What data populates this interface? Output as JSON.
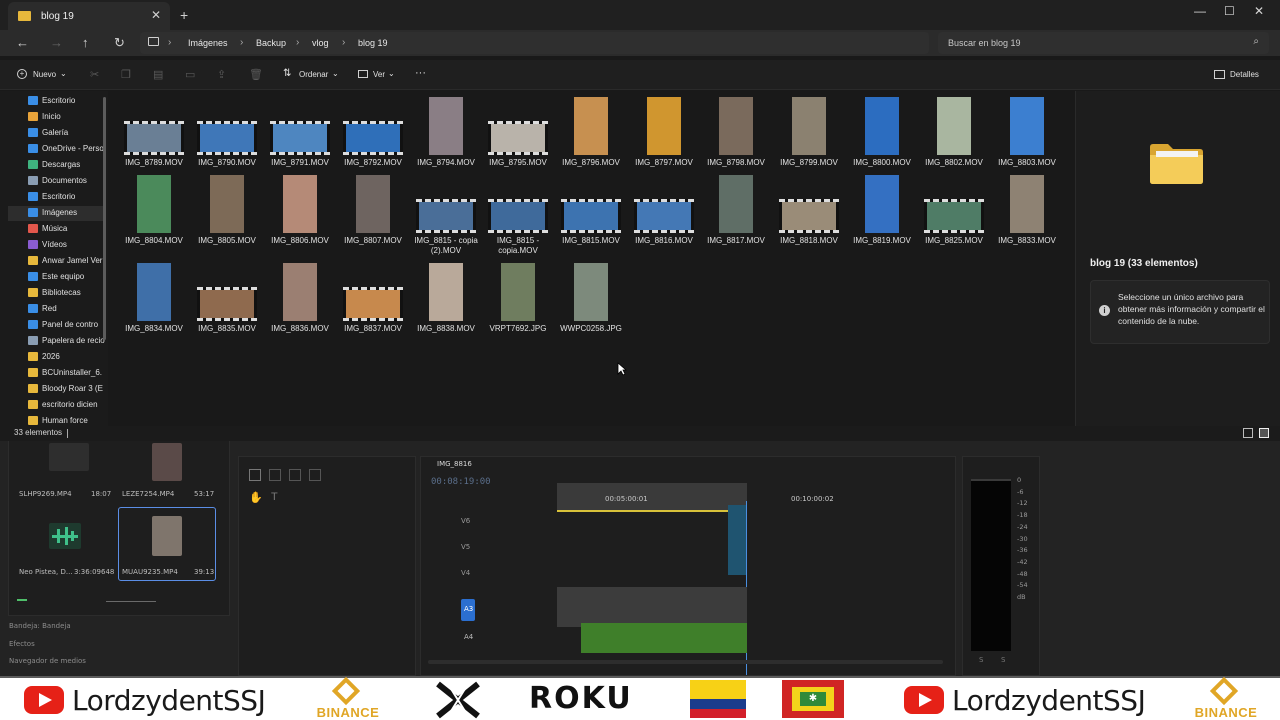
{
  "explorer": {
    "tab_title": "blog 19",
    "breadcrumb": [
      "Imágenes",
      "Backup",
      "vlog",
      "blog 19"
    ],
    "search_placeholder": "Buscar en blog 19",
    "commands": {
      "new": "Nuevo",
      "sort": "Ordenar",
      "view": "Ver",
      "more": "···",
      "details": "Detalles"
    },
    "nav_items": [
      {
        "label": "Escritorio",
        "icon": "desktop-icon",
        "color": "#3a8ee6"
      },
      {
        "label": "Inicio",
        "icon": "home-icon",
        "color": "#e8a33a"
      },
      {
        "label": "Galería",
        "icon": "gallery-icon",
        "color": "#3a8ee6"
      },
      {
        "label": "OneDrive - Perso",
        "icon": "cloud-icon",
        "color": "#3a8ee6"
      },
      {
        "label": "Descargas",
        "icon": "download-icon",
        "color": "#3fb37f"
      },
      {
        "label": "Documentos",
        "icon": "document-icon",
        "color": "#8a9db3"
      },
      {
        "label": "Escritorio",
        "icon": "desktop-icon",
        "color": "#3a8ee6"
      },
      {
        "label": "Imágenes",
        "icon": "pictures-icon",
        "color": "#3a8ee6"
      },
      {
        "label": "Música",
        "icon": "music-icon",
        "color": "#e2574c"
      },
      {
        "label": "Vídeos",
        "icon": "video-icon",
        "color": "#8a5cd1"
      },
      {
        "label": "Anwar Jamel Ver",
        "icon": "user-icon",
        "color": "#e7b83c"
      },
      {
        "label": "Este equipo",
        "icon": "computer-icon",
        "color": "#3a8ee6"
      },
      {
        "label": "Bibliotecas",
        "icon": "library-icon",
        "color": "#e7b83c"
      },
      {
        "label": "Red",
        "icon": "network-icon",
        "color": "#3a8ee6"
      },
      {
        "label": "Panel de contro",
        "icon": "control-panel-icon",
        "color": "#3a8ee6"
      },
      {
        "label": "Papelera de recio",
        "icon": "recycle-bin-icon",
        "color": "#8a9db3"
      },
      {
        "label": "2026",
        "icon": "folder-icon",
        "color": "#e7b83c"
      },
      {
        "label": "BCUninstaller_6.",
        "icon": "folder-icon",
        "color": "#e7b83c"
      },
      {
        "label": "Bloody Roar 3 (E",
        "icon": "folder-icon",
        "color": "#e7b83c"
      },
      {
        "label": "escritorio dicien",
        "icon": "folder-icon",
        "color": "#e7b83c"
      },
      {
        "label": "Human force",
        "icon": "folder-icon",
        "color": "#e7b83c"
      }
    ],
    "files": [
      {
        "name": "IMG_8789.MOV",
        "kind": "video-h",
        "color": "#6a7f95"
      },
      {
        "name": "IMG_8790.MOV",
        "kind": "video-h",
        "color": "#3f77b8"
      },
      {
        "name": "IMG_8791.MOV",
        "kind": "video-h",
        "color": "#4e86c0"
      },
      {
        "name": "IMG_8792.MOV",
        "kind": "video-h",
        "color": "#2f6fb9"
      },
      {
        "name": "IMG_8794.MOV",
        "kind": "video-v",
        "color": "#8a7e85"
      },
      {
        "name": "IMG_8795.MOV",
        "kind": "video-h",
        "color": "#b9b3aa"
      },
      {
        "name": "IMG_8796.MOV",
        "kind": "video-v",
        "color": "#c79050"
      },
      {
        "name": "IMG_8797.MOV",
        "kind": "video-v",
        "color": "#d0962f"
      },
      {
        "name": "IMG_8798.MOV",
        "kind": "video-v",
        "color": "#7a6a5c"
      },
      {
        "name": "IMG_8799.MOV",
        "kind": "video-v",
        "color": "#8b8170"
      },
      {
        "name": "IMG_8800.MOV",
        "kind": "video-v",
        "color": "#2c6dc0"
      },
      {
        "name": "IMG_8802.MOV",
        "kind": "video-v",
        "color": "#a9b6a0"
      },
      {
        "name": "IMG_8803.MOV",
        "kind": "video-v",
        "color": "#3c7fd0"
      },
      {
        "name": "IMG_8804.MOV",
        "kind": "video-v",
        "color": "#4b8a5b"
      },
      {
        "name": "IMG_8805.MOV",
        "kind": "video-v",
        "color": "#7d6a57"
      },
      {
        "name": "IMG_8806.MOV",
        "kind": "video-v",
        "color": "#b58a77"
      },
      {
        "name": "IMG_8807.MOV",
        "kind": "video-v",
        "color": "#6e6460"
      },
      {
        "name": "IMG_8815 - copia (2).MOV",
        "kind": "video-h",
        "color": "#4a6e98"
      },
      {
        "name": "IMG_8815 - copia.MOV",
        "kind": "video-h",
        "color": "#3f6a9b"
      },
      {
        "name": "IMG_8815.MOV",
        "kind": "video-h",
        "color": "#3d73b0"
      },
      {
        "name": "IMG_8816.MOV",
        "kind": "video-h",
        "color": "#4478b5"
      },
      {
        "name": "IMG_8817.MOV",
        "kind": "video-v",
        "color": "#5f6e66"
      },
      {
        "name": "IMG_8818.MOV",
        "kind": "video-h",
        "color": "#9a8c78"
      },
      {
        "name": "IMG_8819.MOV",
        "kind": "video-v",
        "color": "#3470c2"
      },
      {
        "name": "IMG_8825.MOV",
        "kind": "video-h",
        "color": "#4f7c66"
      },
      {
        "name": "IMG_8833.MOV",
        "kind": "video-v",
        "color": "#8e8273"
      },
      {
        "name": "IMG_8834.MOV",
        "kind": "video-v",
        "color": "#3f6fa8"
      },
      {
        "name": "IMG_8835.MOV",
        "kind": "video-h",
        "color": "#8f6a4e"
      },
      {
        "name": "IMG_8836.MOV",
        "kind": "video-v",
        "color": "#9b7f72"
      },
      {
        "name": "IMG_8837.MOV",
        "kind": "video-h",
        "color": "#c7894d"
      },
      {
        "name": "IMG_8838.MOV",
        "kind": "video-v",
        "color": "#b9a99a"
      },
      {
        "name": "VRPT7692.JPG",
        "kind": "photo-v",
        "color": "#6f7d5f"
      },
      {
        "name": "WWPC0258.JPG",
        "kind": "photo-v",
        "color": "#7d8a7c"
      }
    ],
    "details": {
      "title": "blog 19 (33 elementos)",
      "info": "Seleccione un único archivo para obtener más información y compartir el contenido de la nube."
    },
    "status": "33 elementos"
  },
  "premiere": {
    "project_items": [
      {
        "name": "SLHP9269.MP4",
        "duration": "18:07"
      },
      {
        "name": "LEZE7254.MP4",
        "duration": "53:17"
      },
      {
        "name": "Neo Pistea, D...",
        "duration": "3:36:09648"
      },
      {
        "name": "MUAU9235.MP4",
        "duration": "39:13"
      }
    ],
    "panels": [
      "Bandeja: Bandeja",
      "Efectos",
      "Navegador de medios"
    ],
    "sequence_name": "IMG_8816",
    "timecode": "00:08:19:00",
    "ruler_marks": [
      "00:05:00:01",
      "00:10:00:02"
    ],
    "tracks_video": [
      "V6",
      "V5",
      "V4"
    ],
    "tracks_audio": [
      "A3",
      "A4"
    ],
    "meter_labels": [
      "0",
      "-6",
      "-12",
      "-18",
      "-24",
      "-30",
      "-36",
      "-42",
      "-48",
      "-54",
      "dB"
    ],
    "meter_bottom": [
      "S",
      "S"
    ]
  },
  "banner": {
    "channel": "LordzydentSSJ",
    "binance": "BINANCE",
    "roku": "ROKU"
  }
}
